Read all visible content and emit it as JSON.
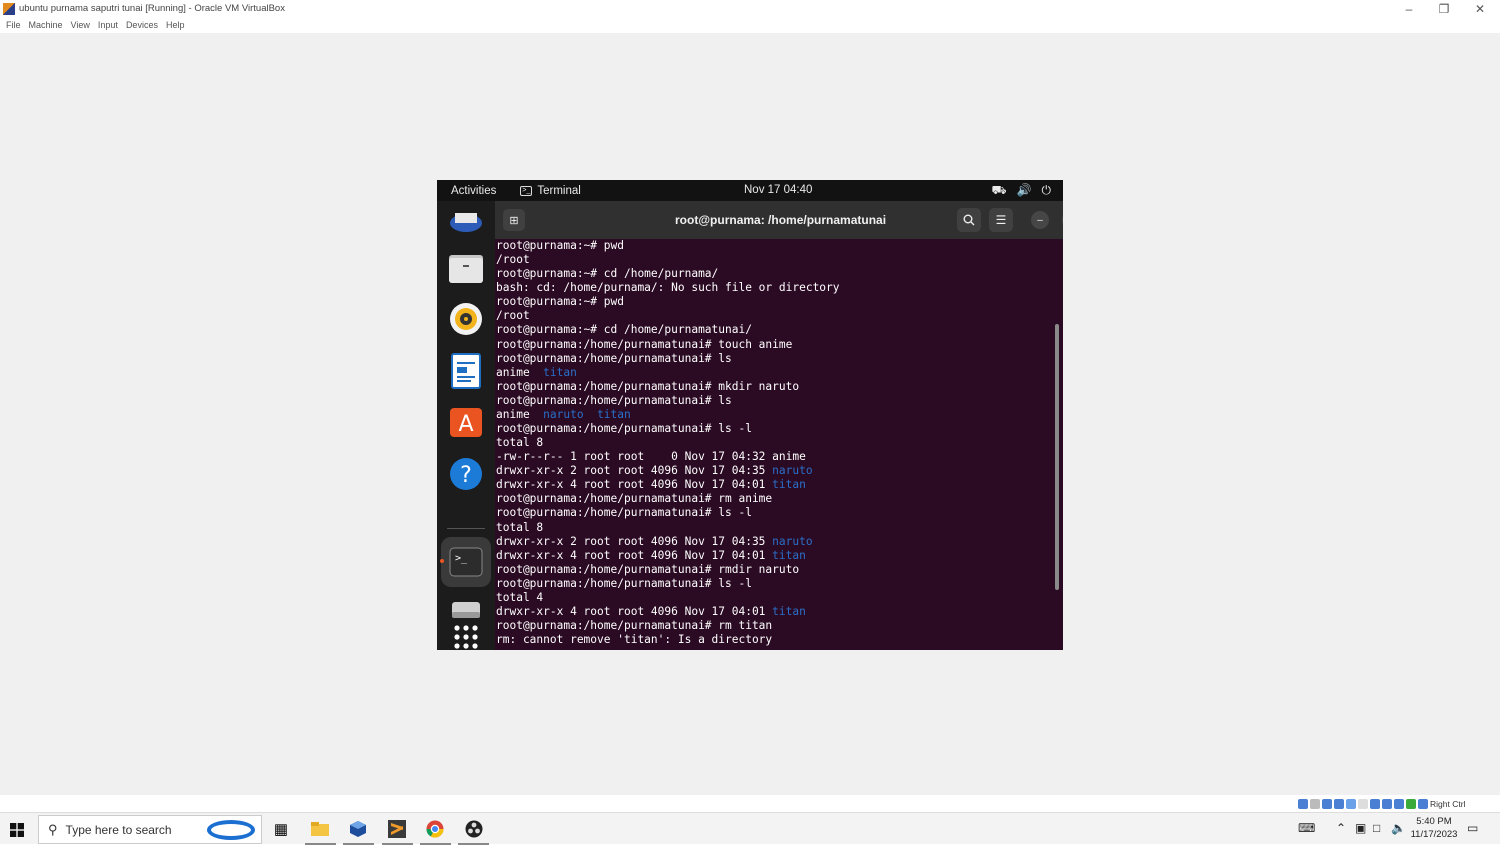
{
  "vbox": {
    "title": "ubuntu purnama saputri tunai [Running] - Oracle VM VirtualBox",
    "menu": [
      "File",
      "Machine",
      "View",
      "Input",
      "Devices",
      "Help"
    ],
    "window_controls": {
      "minimize": "–",
      "restore": "❐",
      "close": "✕"
    },
    "host_key": "Right Ctrl"
  },
  "gnome": {
    "activities": "Activities",
    "app_name": "Terminal",
    "clock": "Nov 17  04:40",
    "tray_icons": [
      "network-icon",
      "volume-icon",
      "power-icon"
    ]
  },
  "dock": {
    "items": [
      "thunderbird-icon",
      "files-icon",
      "rhythmbox-icon",
      "writer-icon",
      "app-center-icon",
      "help-icon",
      "terminal-icon",
      "drive-icon",
      "app-grid-icon"
    ]
  },
  "terminal": {
    "title": "root@purnama: /home/purnamatunai",
    "lines": [
      [
        {
          "t": "root@purnama:~# pwd"
        }
      ],
      [
        {
          "t": "/root"
        }
      ],
      [
        {
          "t": "root@purnama:~# cd /home/purnama/"
        }
      ],
      [
        {
          "t": "bash: cd: /home/purnama/: No such file or directory"
        }
      ],
      [
        {
          "t": "root@purnama:~# pwd"
        }
      ],
      [
        {
          "t": "/root"
        }
      ],
      [
        {
          "t": "root@purnama:~# cd /home/purnamatunai/"
        }
      ],
      [
        {
          "t": "root@purnama:/home/purnamatunai# touch anime"
        }
      ],
      [
        {
          "t": "root@purnama:/home/purnamatunai# ls"
        }
      ],
      [
        {
          "t": "anime  "
        },
        {
          "t": "titan",
          "c": "dir"
        }
      ],
      [
        {
          "t": "root@purnama:/home/purnamatunai# mkdir naruto"
        }
      ],
      [
        {
          "t": "root@purnama:/home/purnamatunai# ls"
        }
      ],
      [
        {
          "t": "anime  "
        },
        {
          "t": "naruto",
          "c": "dir"
        },
        {
          "t": "  "
        },
        {
          "t": "titan",
          "c": "dir"
        }
      ],
      [
        {
          "t": "root@purnama:/home/purnamatunai# ls -l"
        }
      ],
      [
        {
          "t": "total 8"
        }
      ],
      [
        {
          "t": "-rw-r--r-- 1 root root    0 Nov 17 04:32 anime"
        }
      ],
      [
        {
          "t": "drwxr-xr-x 2 root root 4096 Nov 17 04:35 "
        },
        {
          "t": "naruto",
          "c": "dir"
        }
      ],
      [
        {
          "t": "drwxr-xr-x 4 root root 4096 Nov 17 04:01 "
        },
        {
          "t": "titan",
          "c": "dir"
        }
      ],
      [
        {
          "t": "root@purnama:/home/purnamatunai# rm anime"
        }
      ],
      [
        {
          "t": "root@purnama:/home/purnamatunai# ls -l"
        }
      ],
      [
        {
          "t": "total 8"
        }
      ],
      [
        {
          "t": "drwxr-xr-x 2 root root 4096 Nov 17 04:35 "
        },
        {
          "t": "naruto",
          "c": "dir"
        }
      ],
      [
        {
          "t": "drwxr-xr-x 4 root root 4096 Nov 17 04:01 "
        },
        {
          "t": "titan",
          "c": "dir"
        }
      ],
      [
        {
          "t": "root@purnama:/home/purnamatunai# rmdir naruto"
        }
      ],
      [
        {
          "t": "root@purnama:/home/purnamatunai# ls -l"
        }
      ],
      [
        {
          "t": "total 4"
        }
      ],
      [
        {
          "t": "drwxr-xr-x 4 root root 4096 Nov 17 04:01 "
        },
        {
          "t": "titan",
          "c": "dir"
        }
      ],
      [
        {
          "t": "root@purnama:/home/purnamatunai# rm titan"
        }
      ],
      [
        {
          "t": "rm: cannot remove 'titan': Is a directory"
        }
      ]
    ]
  },
  "taskbar": {
    "search_placeholder": "Type here to search",
    "apps": [
      "task-view-icon",
      "file-explorer-icon",
      "virtualbox-icon",
      "sublime-icon",
      "chrome-icon",
      "obs-icon"
    ],
    "time": "5:40 PM",
    "date": "11/17/2023"
  },
  "colors": {
    "terminal_bg": "#2b0a23",
    "directory": "#2a6fc9",
    "accent": "#e95420"
  }
}
